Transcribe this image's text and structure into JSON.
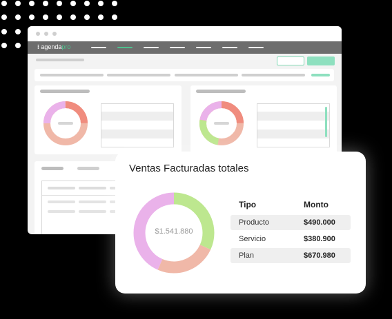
{
  "app": {
    "logo_text": "agenda",
    "logo_accent": "pro"
  },
  "card": {
    "title": "Ventas Facturadas totales",
    "total": "$1.541.880",
    "headers": {
      "tipo": "Tipo",
      "monto": "Monto"
    },
    "rows": [
      {
        "tipo": "Producto",
        "monto": "$490.000"
      },
      {
        "tipo": "Servicio",
        "monto": "$380.900"
      },
      {
        "tipo": "Plan",
        "monto": "$670.980"
      }
    ]
  },
  "chart_data": {
    "type": "pie",
    "title": "Ventas Facturadas totales",
    "categories": [
      "Producto",
      "Servicio",
      "Plan"
    ],
    "values": [
      490000,
      380900,
      670980
    ],
    "colors": [
      "#bde78f",
      "#f0b8a8",
      "#eab2ea"
    ]
  },
  "colors": {
    "brand_green": "#4fc08d",
    "accent_red": "#f08c7e",
    "accent_pink": "#eab2ea",
    "accent_peach": "#f0b8a8",
    "accent_green": "#bde78f"
  }
}
